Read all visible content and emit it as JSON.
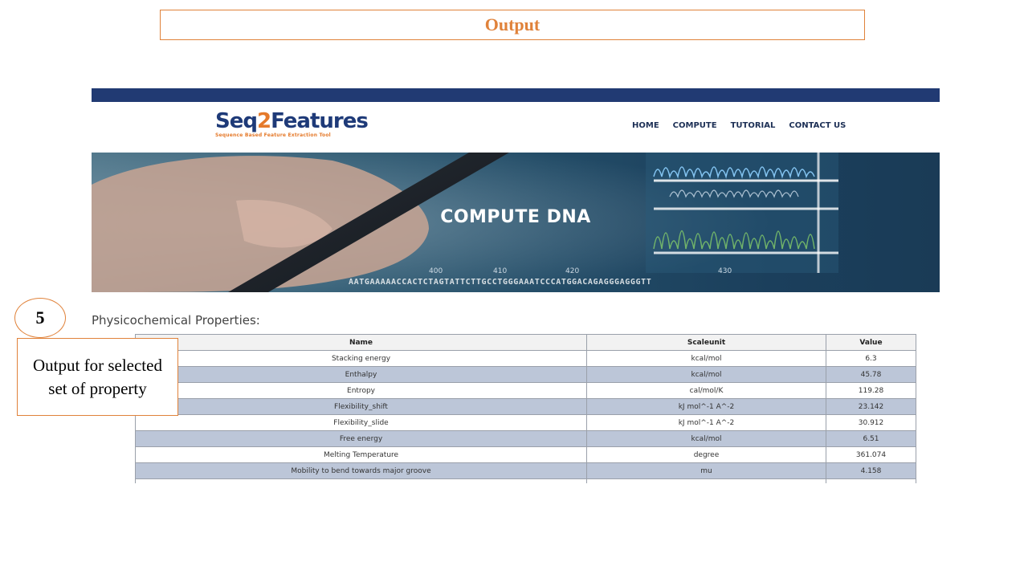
{
  "slide": {
    "title": "Output",
    "accent_color": "#e0823a"
  },
  "site": {
    "brand": {
      "name_prefix": "Seq",
      "name_digit": "2",
      "name_suffix": "Features",
      "tagline": "Sequence Based Feature Extraction Tool",
      "colors": {
        "primary": "#1e3a78",
        "accent": "#e57a2b"
      }
    },
    "nav": {
      "home": "HOME",
      "compute": "COMPUTE",
      "tutorial": "TUTORIAL",
      "contact": "CONTACT US"
    },
    "banner": {
      "title": "COMPUTE DNA",
      "axis_labels": [
        "400",
        "410",
        "420",
        "430"
      ],
      "sequence": "AATGAAAAACCACTCTAGTATTCTTGCCTGGGAAATCCCATGGACAGAGGGAGGGTT"
    },
    "section_title": "Physicochemical Properties:",
    "table": {
      "headers": {
        "name": "Name",
        "scale": "Scaleunit",
        "value": "Value"
      },
      "rows": [
        {
          "name": "Stacking energy",
          "scale": "kcal/mol",
          "value": "6.3"
        },
        {
          "name": "Enthalpy",
          "scale": "kcal/mol",
          "value": "45.78"
        },
        {
          "name": "Entropy",
          "scale": "cal/mol/K",
          "value": "119.28"
        },
        {
          "name": "Flexibility_shift",
          "scale": "kJ mol^-1 A^-2",
          "value": "23.142"
        },
        {
          "name": "Flexibility_slide",
          "scale": "kJ mol^-1 A^-2",
          "value": "30.912"
        },
        {
          "name": "Free energy",
          "scale": "kcal/mol",
          "value": "6.51"
        },
        {
          "name": "Melting Temperature",
          "scale": "degree",
          "value": "361.074"
        },
        {
          "name": "Mobility to bend towards major groove",
          "scale": "mu",
          "value": "4.158"
        }
      ],
      "row_alt_color": "#bcc6d8"
    }
  },
  "callout": {
    "number": "5",
    "text": "Output for selected set of property"
  }
}
